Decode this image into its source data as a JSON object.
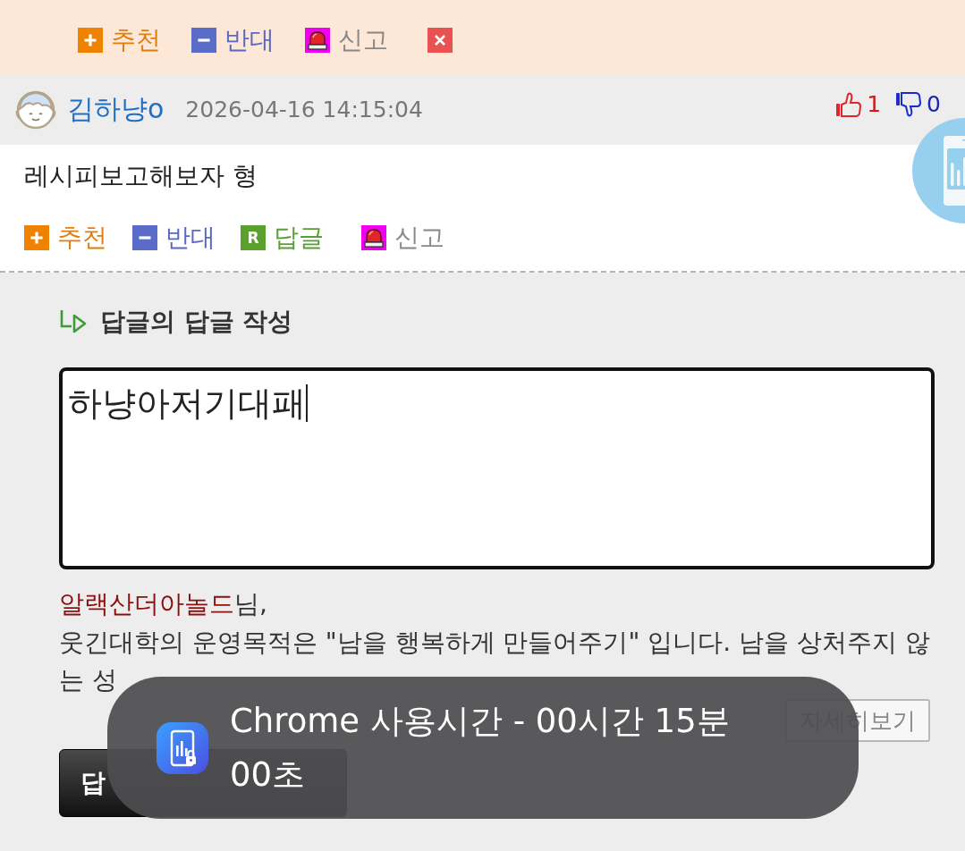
{
  "top_actions": [
    {
      "kind": "recommend",
      "label": "추천"
    },
    {
      "kind": "oppose",
      "label": "반대"
    },
    {
      "kind": "report",
      "label": "신고"
    },
    {
      "kind": "close"
    }
  ],
  "comment": {
    "author": "김하냥o",
    "timestamp": "2026-04-16 14:15:04",
    "likes": "1",
    "dislikes": "0",
    "body": "레시피보고해보자 형",
    "actions": [
      {
        "kind": "recommend",
        "label": "추천"
      },
      {
        "kind": "oppose",
        "label": "반대"
      },
      {
        "kind": "reply",
        "badge": "R",
        "label": "답글"
      },
      {
        "kind": "report",
        "label": "신고"
      }
    ]
  },
  "reply_form": {
    "title": "답글의 답글 작성",
    "value": "하냥아저기대패",
    "notice": {
      "user_name": "알랙산더아놀드",
      "suffix": "님,",
      "message": "웃긴대학의 운영목적은 \"남을 행복하게 만들어주기\" 입니다. 남을 상처주지 않는 성",
      "details_button": "자세히보기"
    },
    "buttons": [
      {
        "kind": "primary",
        "label": "답"
      }
    ]
  },
  "toast": {
    "text": "Chrome 사용시간 - 00시간 15분 00초"
  }
}
